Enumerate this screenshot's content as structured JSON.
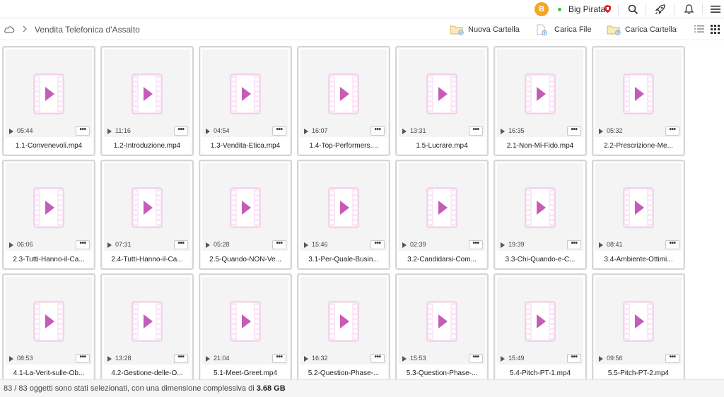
{
  "header": {
    "avatar_letter": "B",
    "username": "Big Pirata",
    "online_color": "#2ecc40",
    "avatar_color": "#f5a623"
  },
  "toolbar": {
    "breadcrumb": "Vendita Telefonica d'Assalto",
    "new_folder": "Nuova Cartella",
    "upload_file": "Carica File",
    "upload_folder": "Carica Cartella"
  },
  "files": [
    {
      "name": "1.1-Convenevoli.mp4",
      "duration": "05:44"
    },
    {
      "name": "1.2-Introduzione.mp4",
      "duration": "11:16"
    },
    {
      "name": "1.3-Vendita-Etica.mp4",
      "duration": "04:54"
    },
    {
      "name": "1.4-Top-Performers....",
      "duration": "16:07"
    },
    {
      "name": "1.5-Lucrare.mp4",
      "duration": "13:31"
    },
    {
      "name": "2.1-Non-Mi-Fido.mp4",
      "duration": "16:35"
    },
    {
      "name": "2.2-Prescrizione-Me...",
      "duration": "05:32"
    },
    {
      "name": "2.3-Tutti-Hanno-il-Ca...",
      "duration": "06:06"
    },
    {
      "name": "2.4-Tutti-Hanno-il-Ca...",
      "duration": "07:31"
    },
    {
      "name": "2.5-Quando-NON-Ve...",
      "duration": "05:28"
    },
    {
      "name": "3.1-Per-Quale-Busin...",
      "duration": "15:46"
    },
    {
      "name": "3.2-Candidarsi-Com...",
      "duration": "02:39"
    },
    {
      "name": "3.3-Chi-Quando-e-C...",
      "duration": "19:39"
    },
    {
      "name": "3.4-Ambiente-Ottimi...",
      "duration": "08:41"
    },
    {
      "name": "4.1-La-Verit-sulle-Ob...",
      "duration": "08:53"
    },
    {
      "name": "4.2-Gestione-delle-O...",
      "duration": "13:28"
    },
    {
      "name": "5.1-Meet-Greet.mp4",
      "duration": "21:04"
    },
    {
      "name": "5.2-Question-Phase-...",
      "duration": "16:32"
    },
    {
      "name": "5.3-Question-Phase-...",
      "duration": "15:53"
    },
    {
      "name": "5.4-Pitch-PT-1.mp4",
      "duration": "15:49"
    },
    {
      "name": "5.5-Pitch-PT-2.mp4",
      "duration": "09:56"
    }
  ],
  "more_label": "•••",
  "status": {
    "prefix": "83 / 83 oggetti sono stati selezionati, con una dimensione complessiva di ",
    "size": "3.68 GB"
  },
  "colors": {
    "video_icon": "#e889d3",
    "video_play": "#c65bb8"
  }
}
